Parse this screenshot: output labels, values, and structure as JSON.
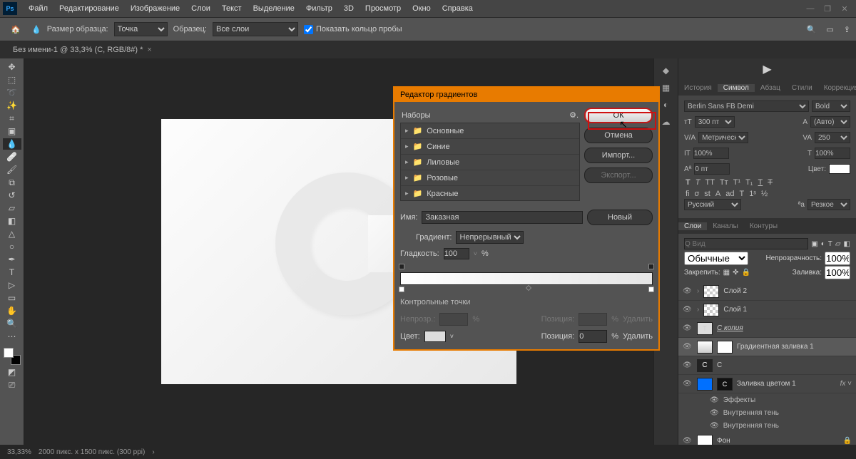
{
  "menu": {
    "file": "Файл",
    "edit": "Редактирование",
    "image": "Изображение",
    "layers": "Слои",
    "text": "Текст",
    "select": "Выделение",
    "filter": "Фильтр",
    "threed": "3D",
    "view": "Просмотр",
    "window": "Окно",
    "help": "Справка"
  },
  "options": {
    "brush_size_lbl": "Размер образца:",
    "brush_size": "Точка",
    "sample_lbl": "Образец:",
    "sample": "Все слои",
    "show_ring": "Показать кольцо пробы"
  },
  "doc_title": "Без имени-1 @ 33,3% (C, RGB/8#) *",
  "status": {
    "zoom": "33,33%",
    "info": "2000 пикс. x 1500 пикс. (300 ppi)"
  },
  "panel_tabs": {
    "history": "История",
    "symbol": "Символ",
    "paragraph": "Абзац",
    "styles": "Стили",
    "correction": "Коррекция"
  },
  "char": {
    "font": "Berlin Sans FB Demi",
    "weight": "Bold",
    "size": "300 пт",
    "leading": "(Авто)",
    "kerning": "Метрически",
    "tracking": "250",
    "hscale": "100%",
    "vscale": "100%",
    "baseline": "0 пт",
    "color_lbl": "Цвет:",
    "lang": "Русский",
    "aa": "Резкое"
  },
  "layer_tabs": {
    "layers": "Слои",
    "channels": "Каналы",
    "paths": "Контуры"
  },
  "layer_opts": {
    "kind_ph": "Q Вид",
    "blend": "Обычные",
    "opacity_lbl": "Непрозрачность:",
    "opacity": "100%",
    "lock_lbl": "Закрепить:",
    "fill_lbl": "Заливка:",
    "fill": "100%"
  },
  "layers": [
    {
      "name": "Слой 2",
      "thumb": "checker"
    },
    {
      "name": "Слой 1",
      "thumb": "checker"
    },
    {
      "name": "С копия",
      "thumb": "t",
      "italic": true,
      "under": true
    },
    {
      "name": "Градиентная заливка 1",
      "thumb": "grad",
      "mask": true,
      "sel": true
    },
    {
      "name": "С",
      "thumb": "c",
      "mask": true
    },
    {
      "name": "Заливка цветом 1",
      "thumb": "blue",
      "mask": "c",
      "fx": true
    },
    {
      "name": "Фон",
      "thumb": "white",
      "lock": true
    }
  ],
  "fx": {
    "effects": "Эффекты",
    "inner1": "Внутренняя тень",
    "inner2": "Внутренняя тень"
  },
  "dialog": {
    "title": "Редактор градиентов",
    "presets_lbl": "Наборы",
    "presets": [
      "Основные",
      "Синие",
      "Лиловые",
      "Розовые",
      "Красные"
    ],
    "ok": "ОК",
    "cancel": "Отмена",
    "import": "Импорт...",
    "export": "Экспорт...",
    "new": "Новый",
    "name_lbl": "Имя:",
    "name": "Заказная",
    "gradient_lbl": "Градиент:",
    "gradient_type": "Непрерывный",
    "smooth_lbl": "Гладкость:",
    "smooth": "100",
    "pct": "%",
    "stops_lbl": "Контрольные точки",
    "opacity_lbl": "Непрозр.:",
    "pos_lbl": "Позиция:",
    "pos_val": "0",
    "delete": "Удалить",
    "color_lbl": "Цвет:"
  }
}
